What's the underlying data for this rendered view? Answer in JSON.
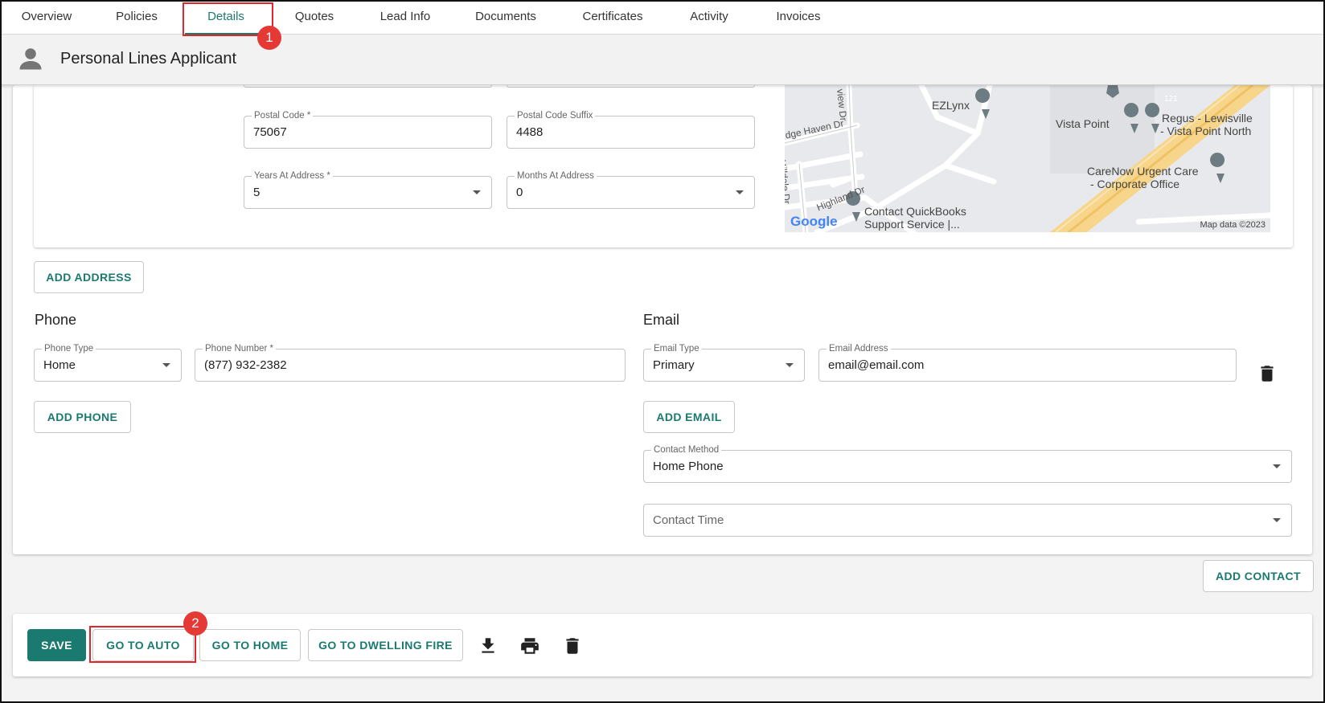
{
  "tabs": [
    {
      "label": "Overview"
    },
    {
      "label": "Policies"
    },
    {
      "label": "Details"
    },
    {
      "label": "Quotes"
    },
    {
      "label": "Lead Info"
    },
    {
      "label": "Documents"
    },
    {
      "label": "Certificates"
    },
    {
      "label": "Activity"
    },
    {
      "label": "Invoices"
    }
  ],
  "active_tab": "Details",
  "header": {
    "title": "Personal Lines Applicant"
  },
  "address": {
    "postal_code": {
      "label": "Postal Code *",
      "value": "75067"
    },
    "postal_code_suffix": {
      "label": "Postal Code Suffix",
      "value": "4488"
    },
    "years_at_address": {
      "label": "Years At Address *",
      "value": "5"
    },
    "months_at_address": {
      "label": "Months At Address",
      "value": "0"
    },
    "add_address_label": "ADD ADDRESS"
  },
  "map": {
    "places": [
      "EZLynx",
      "Vista Point",
      "Regus - Lewisville",
      "- Vista Point North",
      "CareNow Urgent Care",
      "- Corporate Office",
      "Contact QuickBooks",
      "Support Service |..."
    ],
    "streets": [
      "dge Haven Dr",
      "Hilldale Dr",
      "Highland Dr",
      "view Dr"
    ],
    "route": "121",
    "logo": "Google",
    "credit": "Map data ©2023"
  },
  "phone": {
    "section_title": "Phone",
    "type": {
      "label": "Phone Type",
      "value": "Home"
    },
    "number": {
      "label": "Phone Number *",
      "value": "(877) 932-2382"
    },
    "add_label": "ADD PHONE"
  },
  "email": {
    "section_title": "Email",
    "type": {
      "label": "Email Type",
      "value": "Primary"
    },
    "address": {
      "label": "Email Address",
      "value": "email@email.com"
    },
    "add_label": "ADD EMAIL"
  },
  "contact": {
    "method": {
      "label": "Contact Method",
      "value": "Home Phone"
    },
    "time": {
      "placeholder": "Contact Time"
    },
    "add_contact_label": "ADD CONTACT"
  },
  "actions": {
    "save": "SAVE",
    "go_to_auto": "GO TO AUTO",
    "go_to_home": "GO TO HOME",
    "go_to_dwelling_fire": "GO TO DWELLING FIRE"
  },
  "annotations": [
    "1",
    "2"
  ],
  "colors": {
    "accent": "#1a7a6f",
    "highlight": "#e0262b",
    "badge": "#e53935"
  }
}
